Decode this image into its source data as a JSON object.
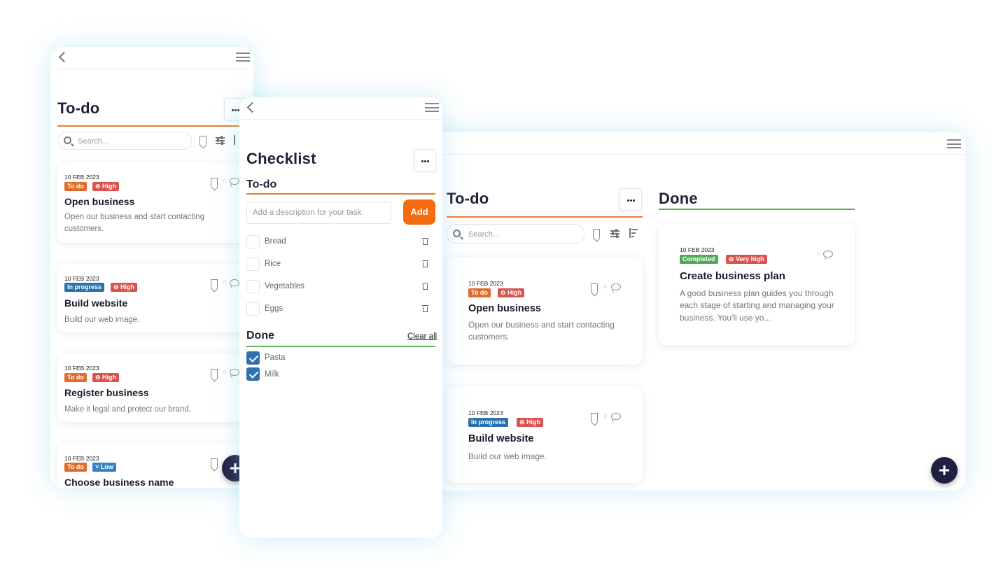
{
  "left": {
    "title": "To-do",
    "search_placeholder": "Search...",
    "cards": [
      {
        "date": "10 FEB 2023",
        "status": "To do",
        "priority": "High",
        "title": "Open business",
        "desc": "Open our business and start contacting customers."
      },
      {
        "date": "10 FEB 2023",
        "status": "In progress",
        "priority": "High",
        "title": "Build website",
        "desc": "Build our web image."
      },
      {
        "date": "10 FEB 2023",
        "status": "To do",
        "priority": "High",
        "title": "Register business",
        "desc": "Make it legal and protect our brand."
      },
      {
        "date": "10 FEB 2023",
        "status": "To do",
        "priority": "Low",
        "title": "Choose business name",
        "desc": ""
      }
    ]
  },
  "checklist": {
    "title": "Checklist",
    "todo_heading": "To-do",
    "input_placeholder": "Add a description for your task",
    "add_label": "Add",
    "todo_items": [
      "Bread",
      "Rice",
      "Vegetables",
      "Eggs"
    ],
    "done_heading": "Done",
    "clear_label": "Clear all",
    "done_items": [
      "Pasta",
      "Milk"
    ]
  },
  "board": {
    "todo_title": "To-do",
    "done_title": "Done",
    "search_placeholder": "Search...",
    "todo_cards": [
      {
        "date": "10 FEB 2023",
        "status": "To do",
        "priority": "High",
        "title": "Open business",
        "desc": "Open our business and start contacting customers."
      },
      {
        "date": "10 FEB 2023",
        "status": "In progress",
        "priority": "High",
        "title": "Build website",
        "desc": "Build our web image."
      }
    ],
    "done_cards": [
      {
        "date": "10 FEB 2023",
        "status": "Completed",
        "priority": "Very high",
        "title": "Create business plan",
        "desc": "A good business plan guides you through each stage of starting and managing your business. You'll use yo..."
      }
    ]
  },
  "colors": {
    "accent_orange": "#f07a2a",
    "done_green": "#5fae58",
    "fab_navy": "#212042"
  },
  "icons": [
    "back-icon",
    "menu-icon",
    "more-icon",
    "search-icon",
    "bookmark-icon",
    "filter-icon",
    "sort-icon",
    "comment-icon",
    "trash-icon",
    "check-icon",
    "plus-icon"
  ]
}
